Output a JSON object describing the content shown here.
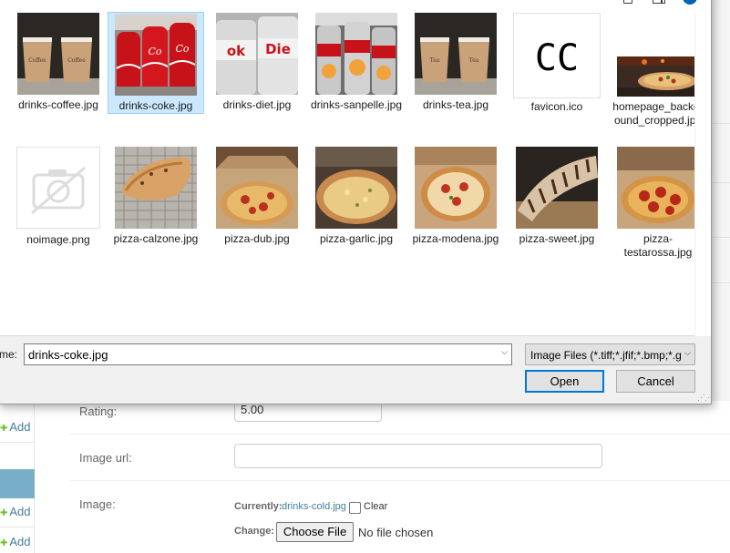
{
  "dialog": {
    "files": [
      {
        "name": "drinks-coffee.jpg",
        "thumb": "coffee"
      },
      {
        "name": "drinks-coke.jpg",
        "thumb": "coke",
        "selected": true
      },
      {
        "name": "drinks-diet.jpg",
        "thumb": "diet"
      },
      {
        "name": "drinks-sanpelle.jpg",
        "thumb": "sanpelle"
      },
      {
        "name": "drinks-tea.jpg",
        "thumb": "tea"
      },
      {
        "name": "favicon.ico",
        "thumb": "favicon"
      },
      {
        "name": "homepage_background_cropped.jpg",
        "thumb": "homepage"
      },
      {
        "name": "noimage.png",
        "thumb": "noimage"
      },
      {
        "name": "pizza-calzone.jpg",
        "thumb": "calzone"
      },
      {
        "name": "pizza-dub.jpg",
        "thumb": "pizza-box"
      },
      {
        "name": "pizza-garlic.jpg",
        "thumb": "garlic"
      },
      {
        "name": "pizza-modena.jpg",
        "thumb": "modena"
      },
      {
        "name": "pizza-sweet.jpg",
        "thumb": "sweet"
      },
      {
        "name": "pizza-testarossa.jpg",
        "thumb": "testarossa"
      }
    ],
    "favicon_text": "CC",
    "file_name_label": "me:",
    "file_name_value": "drinks-coke.jpg",
    "file_type_value": "Image Files (*.tiff;*.jfif;*.bmp;*.g",
    "open_label": "Open",
    "cancel_label": "Cancel",
    "help_glyph": "?",
    "dropdown_glyph": "⌵"
  },
  "background": {
    "add_label": "Add",
    "rating_label": "Rating:",
    "rating_value": "5.00",
    "image_url_label": "Image url:",
    "image_label": "Image:",
    "currently_label": "Currently:",
    "currently_file": "drinks-cold.jpg",
    "clear_label": "Clear",
    "change_label": "Change:",
    "choose_file_label": "Choose File",
    "no_file_label": "No file chosen"
  },
  "colors": {
    "link": "#447e9b",
    "selection": "#cce8ff",
    "default_button_border": "#0078d7",
    "sidebar_accent": "#79aec8"
  }
}
